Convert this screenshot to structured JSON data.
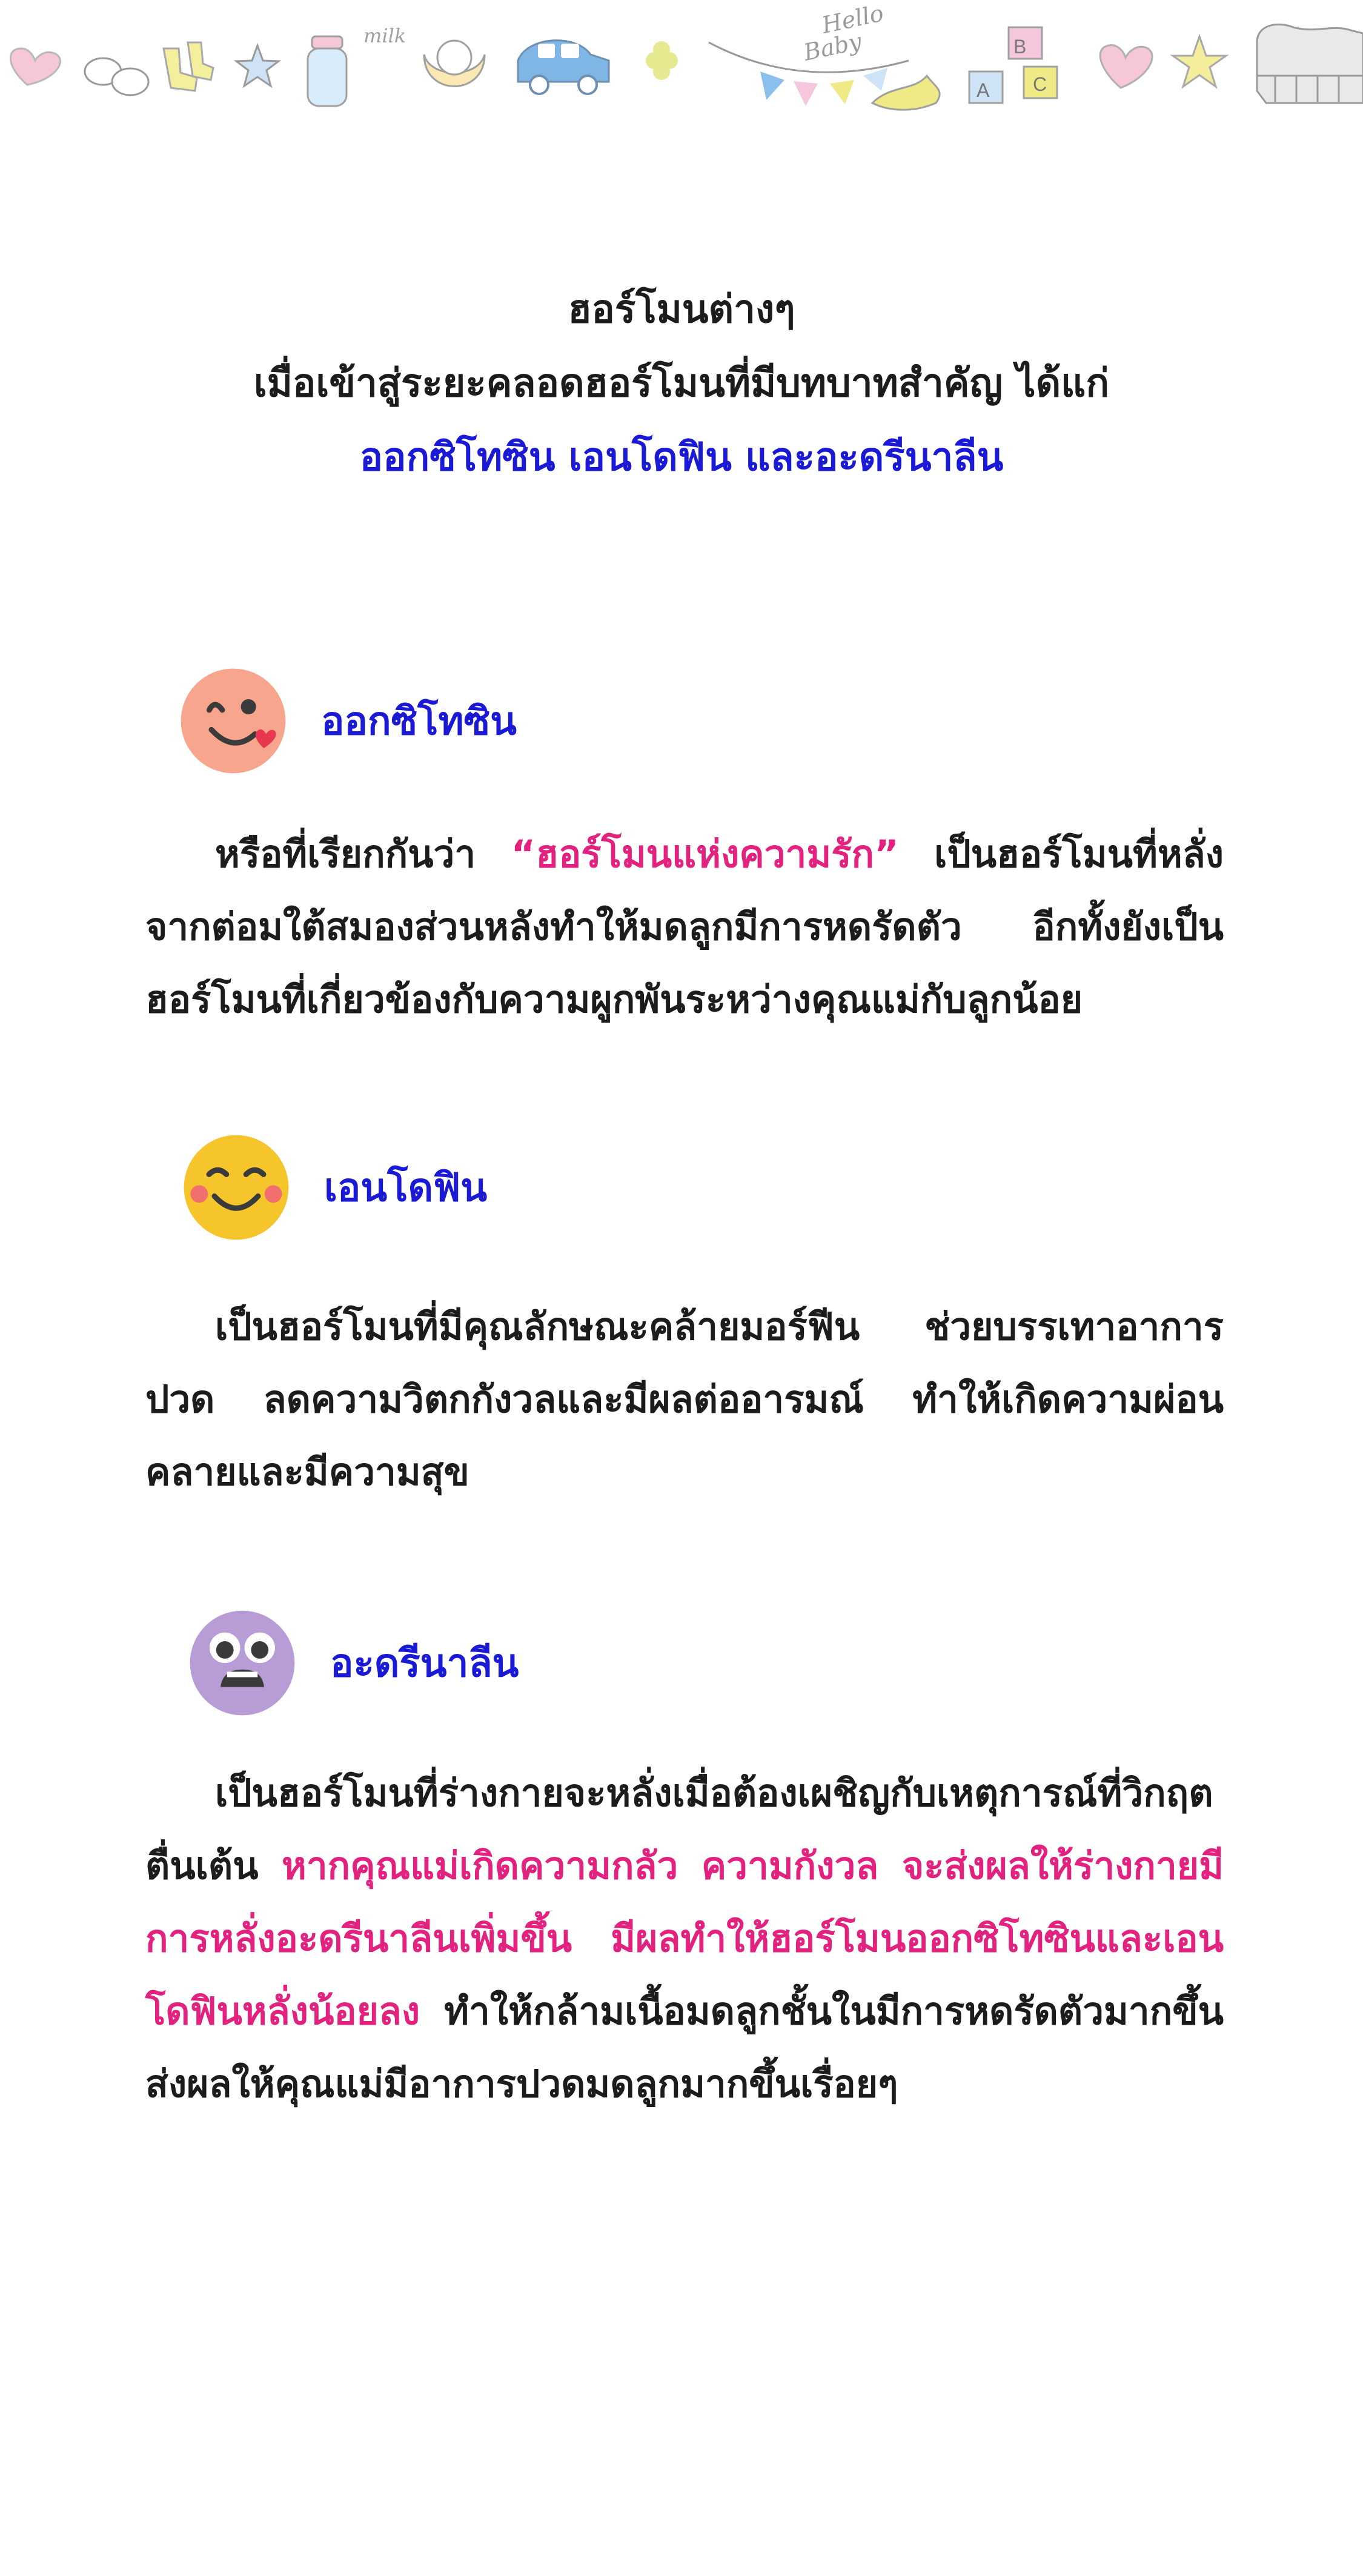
{
  "banner": {
    "milk_label": "milk",
    "hello_label": "Hello",
    "baby_label": "Baby",
    "block_letters": [
      "B",
      "A",
      "C"
    ],
    "icons": [
      "heart-icon",
      "baby-shoes-icon",
      "baby-socks-icon",
      "star-icon",
      "milk-bottle-icon",
      "bib-icon",
      "toy-car-icon",
      "clover-icon",
      "bunting-flags-icon",
      "dove-icon",
      "alphabet-blocks-icon",
      "heart-icon",
      "star-icon",
      "toy-piano-icon"
    ]
  },
  "intro": {
    "line1": "ฮอร์โมนต่างๆ",
    "line2": "เมื่อเข้าสู่ระยะคลอดฮอร์โมนที่มีบทบาทสำคัญ ได้แก่",
    "line3": "ออกซิโทซิน เอนโดฟิน และอะดรีนาลีน"
  },
  "sections": [
    {
      "icon": "love-face-icon",
      "title": "ออกซิโทซิน",
      "parts": [
        "หรือที่เรียกกันว่า ",
        "“ฮอร์โมนแห่งความรัก”",
        " เป็นฮอร์โมนที่หลั่งจากต่อมใต้สมองส่วนหลังทำให้มดลูกมีการหดรัดตัว อีกทั้งยังเป็นฮอร์โมนที่เกี่ยวข้องกับความผูกพันระหว่างคุณแม่กับลูกน้อย"
      ]
    },
    {
      "icon": "happy-face-icon",
      "title": "เอนโดฟิน",
      "parts": [
        "เป็นฮอร์โมนที่มีคุณลักษณะคล้ายมอร์ฟีน ช่วยบรรเทาอาการปวด ลดความวิตกกังวลและมีผลต่ออารมณ์ ทำให้เกิดความผ่อนคลายและมีความสุข"
      ]
    },
    {
      "icon": "scared-face-icon",
      "title": "อะดรีนาลีน",
      "parts": [
        "เป็นฮอร์โมนที่ร่างกายจะหลั่งเมื่อต้องเผชิญกับเหตุการณ์ที่วิกฤต ตื่นเต้น ",
        "หากคุณแม่เกิดความกลัว ความกังวล จะส่งผลให้ร่างกายมีการหลั่งอะดรีนาลีนเพิ่มขึ้น มีผลทำให้ฮอร์โมนออกซิโทซินและเอนโดฟินหลั่งน้อยลง",
        " ทำให้กล้ามเนื้อมดลูกชั้นในมีการหดรัดตัวมากขึ้น ส่งผลให้คุณแม่มีอาการปวดมดลูกมากขึ้นเรื่อยๆ"
      ]
    }
  ],
  "colors": {
    "heading_blue": "#1a1ad6",
    "highlight_pink": "#e2227e",
    "text": "#1c1c1c"
  }
}
